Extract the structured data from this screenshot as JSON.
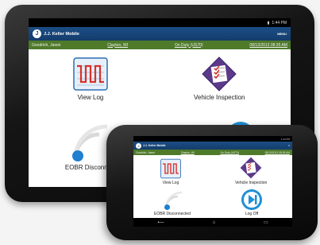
{
  "app": {
    "title": "J.J. Keller Mobile",
    "menu_label": "MENU",
    "status_time": "1:44 PM"
  },
  "infobar": {
    "driver": "Goodrich, Jason",
    "location": "Clayton, WI",
    "duty_status": "On Duty (US70)",
    "datetime": "08/13/2013 08:35 AM"
  },
  "tiles": {
    "view_log": "View Log",
    "vehicle_inspection": "Vehicle Inspection",
    "eobr_tablet": "EOBR Disconne",
    "eobr_phone": "EOBR Disconnected",
    "log_off": "Log Off"
  },
  "phone": {
    "status_time": "1:44 PM"
  },
  "icons": [
    "view-log-icon",
    "vehicle-inspection-icon",
    "eobr-disconnected-icon",
    "log-off-icon"
  ],
  "colors": {
    "appbar": "#1b4e85",
    "infobar": "#4f7a2a",
    "accent": "#1f8fd6"
  }
}
